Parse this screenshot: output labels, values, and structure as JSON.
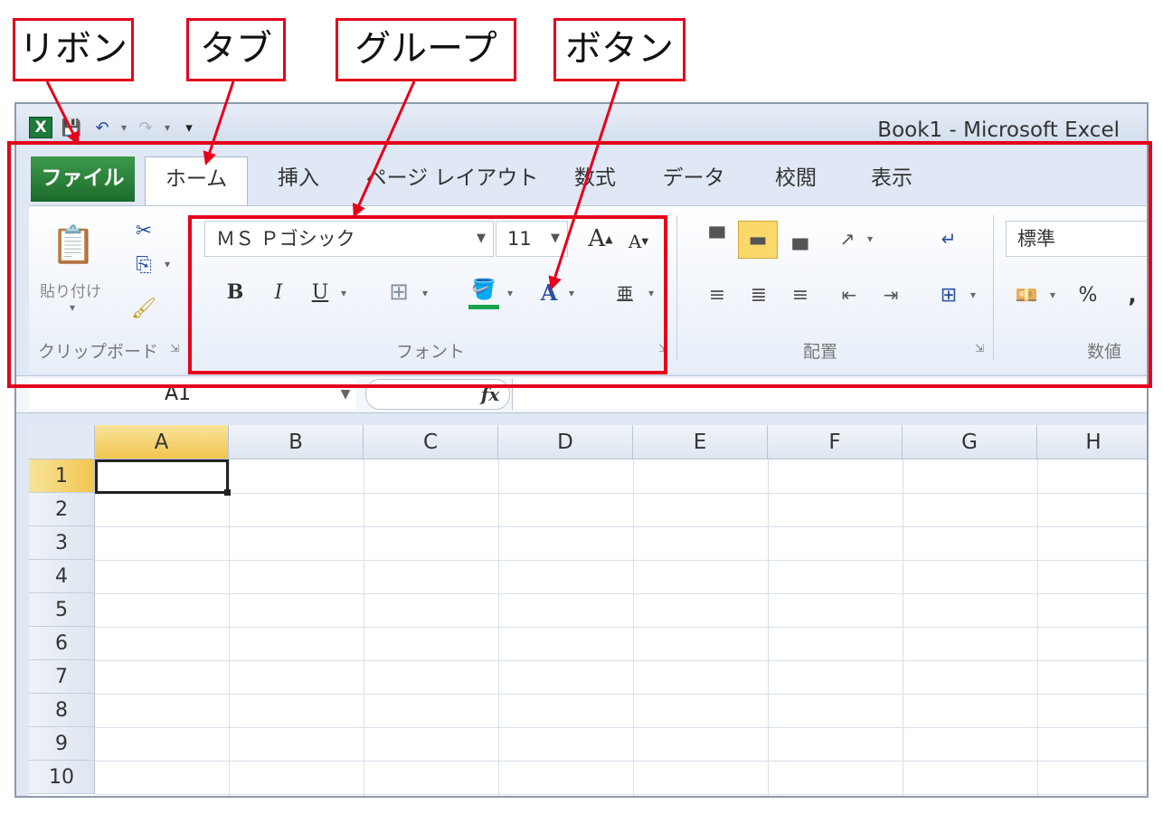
{
  "annotations": {
    "ribbon": "リボン",
    "tab": "タブ",
    "group": "グループ",
    "button": "ボタン"
  },
  "window": {
    "title": "Book1 - Microsoft Excel"
  },
  "tabs": [
    "ファイル",
    "ホーム",
    "挿入",
    "ページ レイアウト",
    "数式",
    "データ",
    "校閲",
    "表示"
  ],
  "clipboard": {
    "paste_label": "貼り付け",
    "group_label": "クリップボード"
  },
  "font": {
    "name": "ＭＳ Ｐゴシック",
    "size": "11",
    "group_label": "フォント"
  },
  "alignment": {
    "group_label": "配置"
  },
  "number": {
    "format": "標準",
    "percent": "%",
    "comma": ",",
    "group_label": "数値"
  },
  "formula_bar": {
    "name_box": "A1",
    "fx": "fx"
  },
  "sheet": {
    "columns": [
      "A",
      "B",
      "C",
      "D",
      "E",
      "F",
      "G",
      "H"
    ],
    "rows": [
      "1",
      "2",
      "3",
      "4",
      "5",
      "6",
      "7",
      "8",
      "9",
      "10"
    ],
    "active_cell": "A1"
  },
  "colors": {
    "annotation": "#e5001c",
    "file_tab": "#1c6b2b",
    "selected_header": "#f0c64f"
  }
}
